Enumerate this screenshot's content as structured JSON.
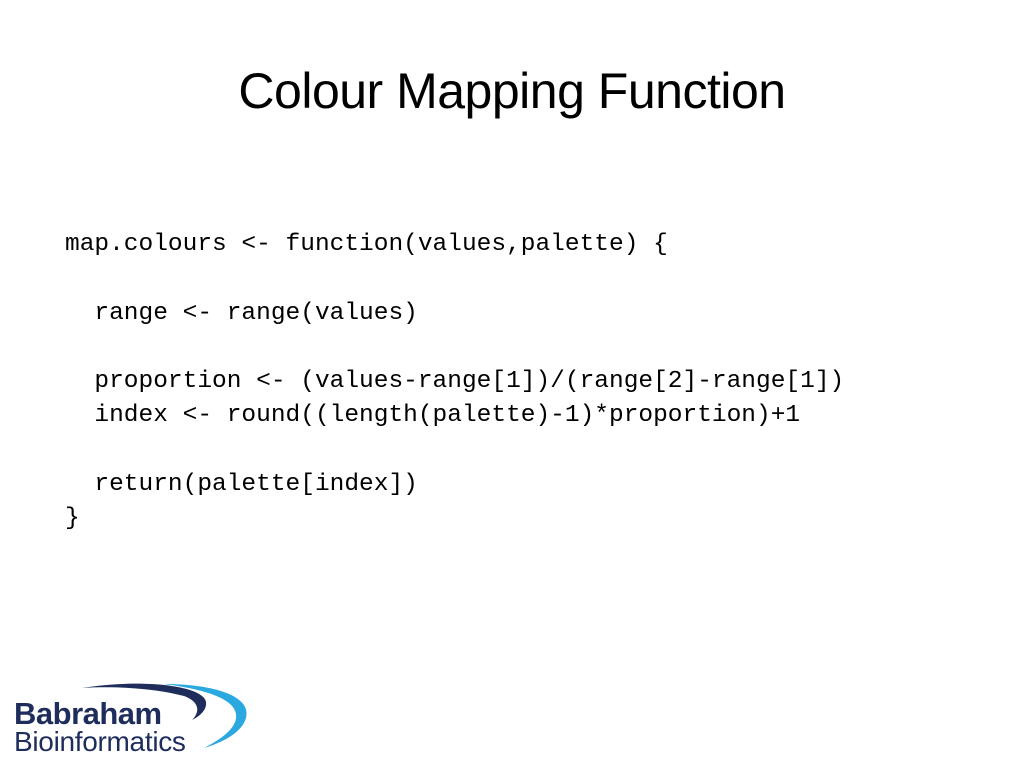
{
  "slide": {
    "title": "Colour Mapping Function",
    "code_lines": [
      "map.colours <- function(values,palette) {",
      "",
      "  range <- range(values)",
      "",
      "  proportion <- (values-range[1])/(range[2]-range[1])",
      "  index <- round((length(palette)-1)*proportion)+1",
      "",
      "  return(palette[index])",
      "}"
    ]
  },
  "logo": {
    "line1": "Babraham",
    "line2": "Bioinformatics",
    "colors": {
      "dark": "#1e2d5c",
      "light": "#2aa8e0"
    }
  }
}
